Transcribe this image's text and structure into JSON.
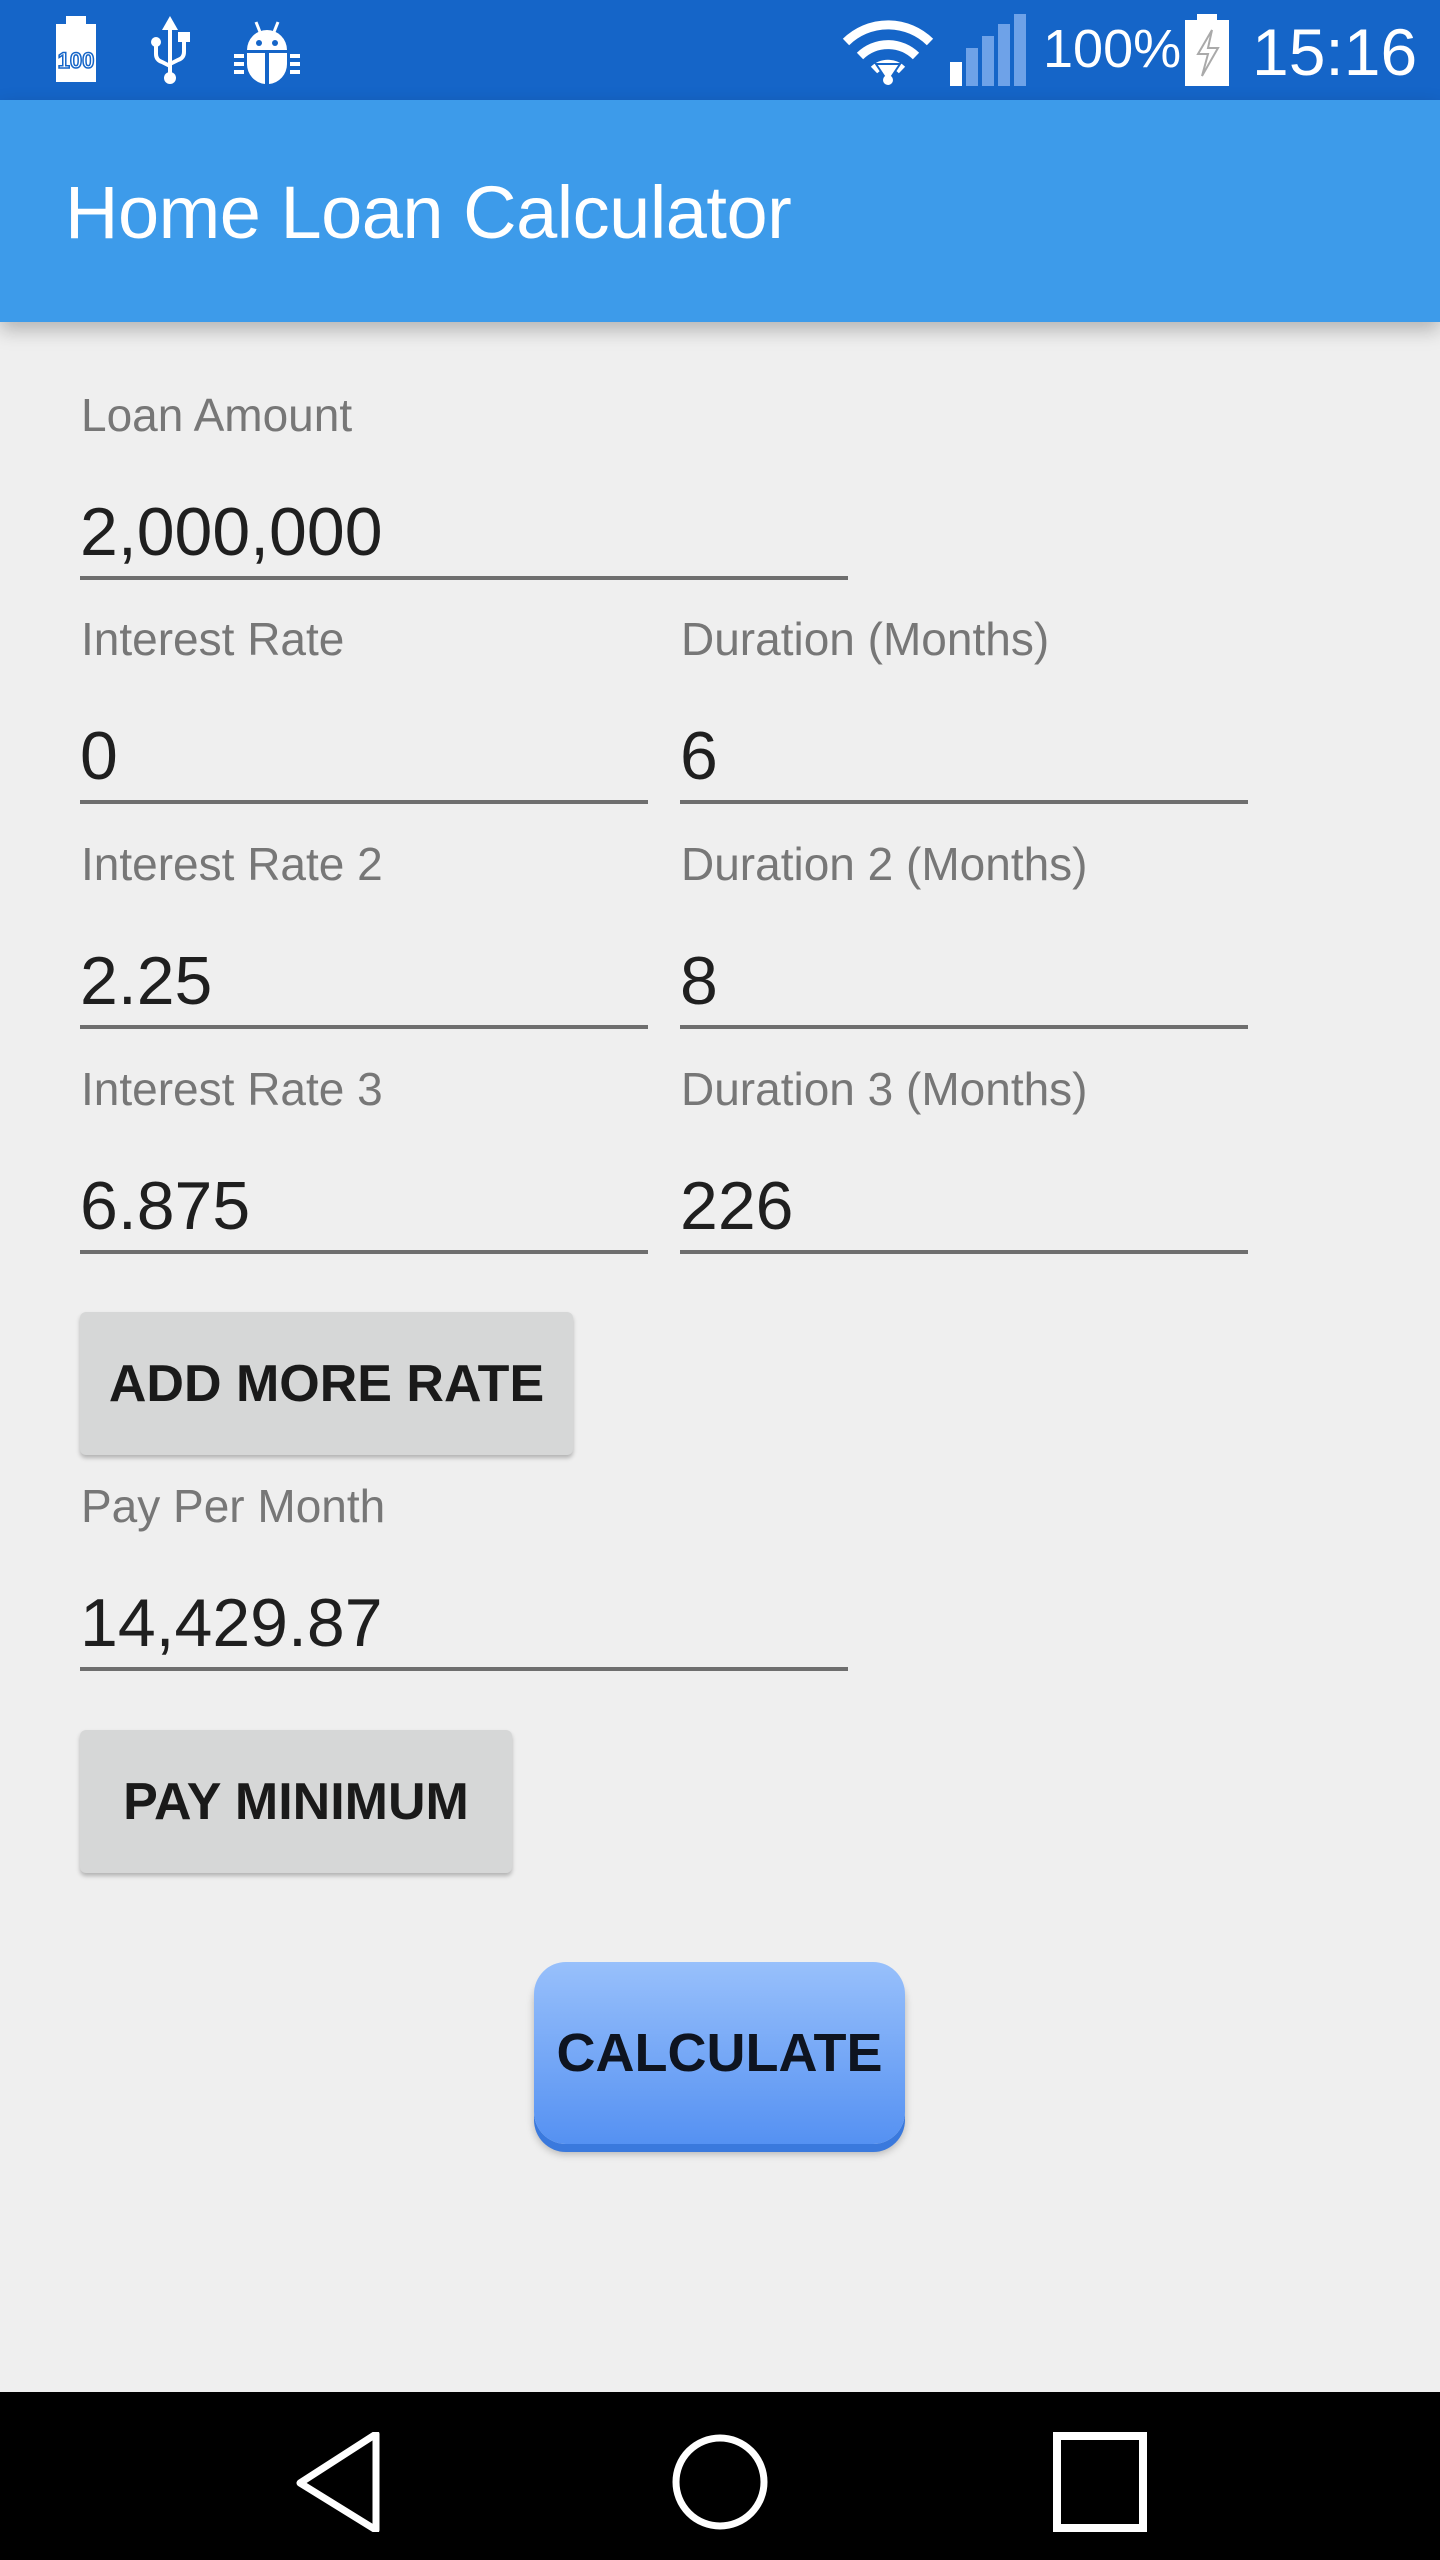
{
  "status_bar": {
    "notification_icons": [
      "battery-100-icon",
      "usb-icon",
      "android-debug-icon"
    ],
    "battery_badge_text": "100",
    "system_icons": [
      "wifi-icon",
      "cell-signal-icon",
      "battery-charging-icon"
    ],
    "battery_percent": "100%",
    "time": "15:16",
    "color": "#1565c8"
  },
  "app_bar": {
    "title": "Home Loan Calculator",
    "color": "#3d9bea"
  },
  "form": {
    "loan_amount": {
      "label": "Loan Amount",
      "value": "2,000,000"
    },
    "rates": [
      {
        "rate_label": "Interest Rate",
        "rate_value": "0",
        "duration_label": "Duration (Months)",
        "duration_value": "6"
      },
      {
        "rate_label": "Interest Rate 2",
        "rate_value": "2.25",
        "duration_label": "Duration 2 (Months)",
        "duration_value": "8"
      },
      {
        "rate_label": "Interest Rate 3",
        "rate_value": "6.875",
        "duration_label": "Duration 3 (Months)",
        "duration_value": "226"
      }
    ],
    "add_more_rate_label": "ADD MORE RATE",
    "pay_per_month": {
      "label": "Pay Per Month",
      "value": "14,429.87"
    },
    "pay_minimum_label": "PAY MINIMUM",
    "calculate_label": "CALCULATE",
    "calculate_color": "#5591f2"
  },
  "nav_bar": {
    "buttons": [
      "back-icon",
      "home-icon",
      "recents-icon"
    ]
  }
}
